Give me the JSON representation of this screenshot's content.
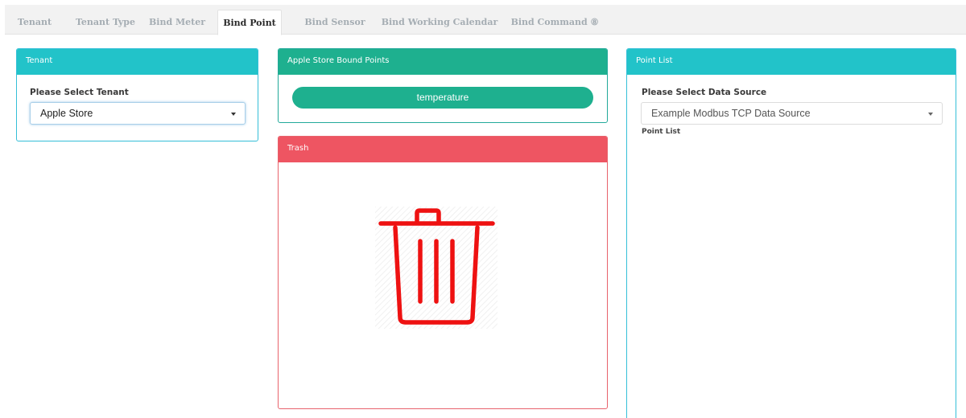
{
  "tabs": [
    {
      "label": "Tenant"
    },
    {
      "label": "Tenant Type"
    },
    {
      "label": "Bind Meter"
    },
    {
      "label": "Bind Point"
    },
    {
      "label": "Bind Sensor"
    },
    {
      "label": "Bind Working Calendar"
    },
    {
      "label": "Bind Command ⑧"
    }
  ],
  "active_tab": "Bind Point",
  "tenant_panel": {
    "title": "Tenant",
    "select_label": "Please Select Tenant",
    "selected_tenant": "Apple Store"
  },
  "bound_panel": {
    "title": "Apple Store Bound Points",
    "points": [
      "temperature"
    ]
  },
  "trash_panel": {
    "title": "Trash",
    "icon": "trash-can-icon"
  },
  "points_panel": {
    "title": "Point List",
    "select_label": "Please Select Data Source",
    "selected_source": "Example Modbus TCP Data Source",
    "list_label": "Point List"
  },
  "colors": {
    "info": "#22c3c9",
    "success": "#1eb08f",
    "danger": "#ee5562",
    "trash_icon": "#ee1111"
  }
}
